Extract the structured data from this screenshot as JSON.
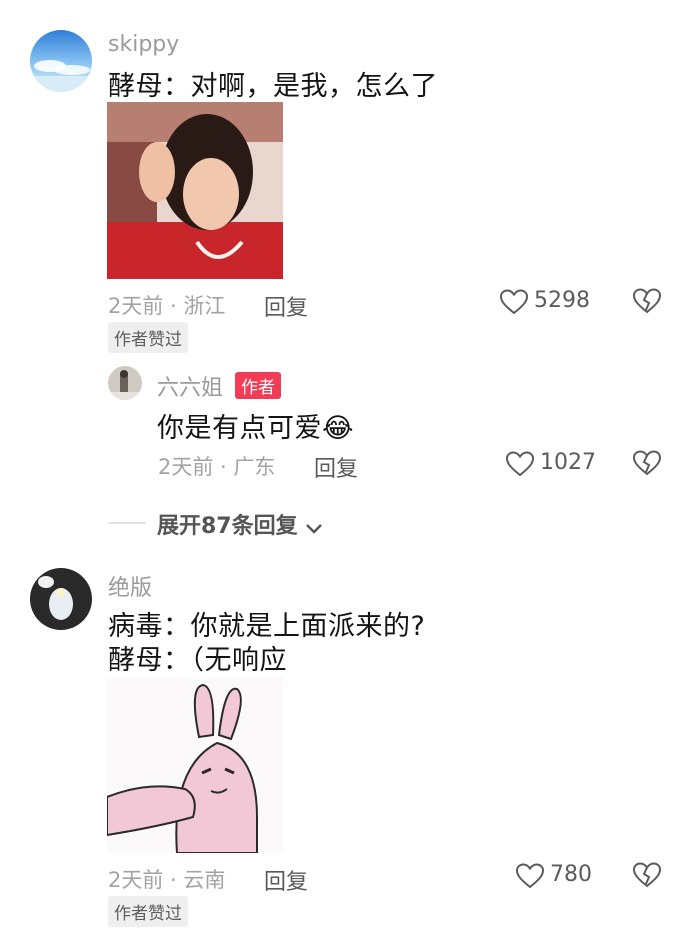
{
  "comments": [
    {
      "username": "skippy",
      "text": "酵母：对啊，是我，怎么了",
      "time_location": "2天前 · 浙江",
      "reply_label": "回复",
      "like_count": "5298",
      "author_liked_badge": "作者赞过",
      "reply": {
        "username": "六六姐",
        "author_badge": "作者",
        "text": "你是有点可爱😂",
        "time_location": "2天前 · 广东",
        "reply_label": "回复",
        "like_count": "1027"
      },
      "expand_label": "展开87条回复"
    },
    {
      "username": "绝版",
      "text_line1": "病毒：你就是上面派来的?",
      "text_line2": "酵母：（无响应",
      "time_location": "2天前 · 云南",
      "reply_label": "回复",
      "like_count": "780",
      "author_liked_badge": "作者赞过"
    }
  ],
  "icons": {
    "like": "heart-outline-icon",
    "dislike": "broken-heart-icon",
    "expand": "chevron-down-icon"
  },
  "colors": {
    "author_badge": "#f23c55",
    "username": "#9b9b9b",
    "meta": "#a3a3a3"
  }
}
